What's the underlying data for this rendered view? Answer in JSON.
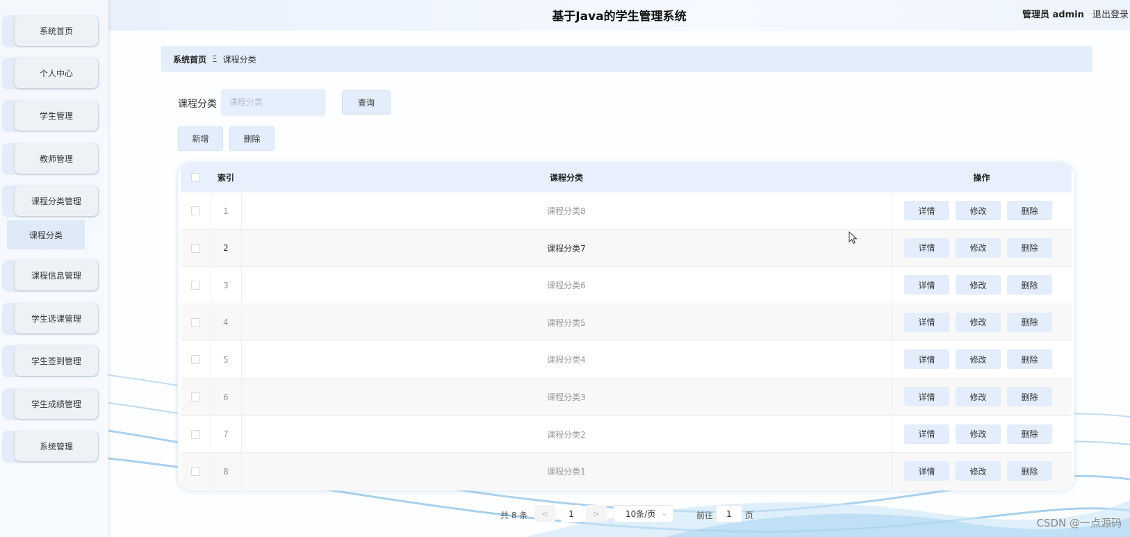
{
  "header": {
    "title": "基于Java的学生管理系统",
    "user": "管理员 admin",
    "logout": "退出登录"
  },
  "sidebar": {
    "items": [
      {
        "label": "系统首页"
      },
      {
        "label": "个人中心"
      },
      {
        "label": "学生管理"
      },
      {
        "label": "教师管理"
      },
      {
        "label": "课程分类管理"
      },
      {
        "label": "课程信息管理"
      },
      {
        "label": "学生选课管理"
      },
      {
        "label": "学生签到管理"
      },
      {
        "label": "学生成绩管理"
      },
      {
        "label": "系统管理"
      }
    ],
    "active_sub": "课程分类"
  },
  "breadcrumb": {
    "home": "系统首页",
    "separator": "Ξ",
    "current": "课程分类"
  },
  "search": {
    "label": "课程分类",
    "placeholder": "课程分类",
    "query_button": "查询"
  },
  "actions": {
    "add": "新增",
    "delete": "删除"
  },
  "table": {
    "headers": {
      "index": "索引",
      "category": "课程分类",
      "operations": "操作"
    },
    "op_labels": {
      "detail": "详情",
      "edit": "修改",
      "delete": "删除"
    },
    "rows": [
      {
        "index": "1",
        "category": "课程分类8"
      },
      {
        "index": "2",
        "category": "课程分类7"
      },
      {
        "index": "3",
        "category": "课程分类6"
      },
      {
        "index": "4",
        "category": "课程分类5"
      },
      {
        "index": "5",
        "category": "课程分类4"
      },
      {
        "index": "6",
        "category": "课程分类3"
      },
      {
        "index": "7",
        "category": "课程分类2"
      },
      {
        "index": "8",
        "category": "课程分类1"
      }
    ],
    "highlighted_row": 2
  },
  "pagination": {
    "total": "共 8 条",
    "prev": "<",
    "page": "1",
    "next": ">",
    "page_size": "10条/页",
    "goto_label": "前往",
    "goto_value": "1",
    "goto_suffix": "页"
  },
  "watermark": "CSDN @一点源码",
  "colors": {
    "accent": "#e3edfb",
    "header_bg": "#e7f0fc",
    "sidebar_bg": "#f4f8fd"
  }
}
